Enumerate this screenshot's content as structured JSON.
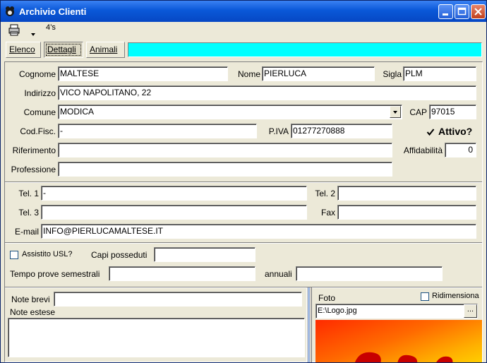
{
  "window": {
    "title": "Archivio Clienti"
  },
  "toolbar": {
    "sort_label": "4’s"
  },
  "tabs": [
    {
      "label": "Elenco"
    },
    {
      "label": "Dettagli"
    },
    {
      "label": "Animali"
    }
  ],
  "anagrafica": {
    "cognome_label": "Cognome",
    "cognome_value": "MALTESE",
    "nome_label": "Nome",
    "nome_value": "PIERLUCA",
    "sigla_label": "Sigla",
    "sigla_value": "PLM",
    "indirizzo_label": "Indirizzo",
    "indirizzo_value": "VICO NAPOLITANO, 22",
    "comune_label": "Comune",
    "comune_value": "MODICA",
    "cap_label": "CAP",
    "cap_value": "97015",
    "codfisc_label": "Cod.Fisc.",
    "codfisc_value": "-",
    "piva_label": "P.IVA",
    "piva_value": "01277270888",
    "attivo_label": "Attivo?",
    "attivo_checked": true,
    "riferimento_label": "Riferimento",
    "riferimento_value": "",
    "affidabilita_label": "Affidabilità",
    "affidabilita_value": "0",
    "professione_label": "Professione",
    "professione_value": ""
  },
  "contatti": {
    "tel1_label": "Tel. 1",
    "tel1_value": "-",
    "tel2_label": "Tel. 2",
    "tel2_value": "",
    "tel3_label": "Tel. 3",
    "tel3_value": "",
    "fax_label": "Fax",
    "fax_value": "",
    "email_label": "E-mail",
    "email_value": "INFO@PIERLUCAMALTESE.IT"
  },
  "usl": {
    "assistito_label": "Assistito USL?",
    "assistito_checked": false,
    "capi_label": "Capi posseduti",
    "capi_value": "",
    "tempo_label": "Tempo prove semestrali",
    "tempo_value": "",
    "annuali_label": "annuali",
    "annuali_value": ""
  },
  "note": {
    "brevi_label": "Note brevi",
    "brevi_value": "",
    "estese_label": "Note estese",
    "estese_value": ""
  },
  "foto": {
    "label": "Foto",
    "ridimensiona_label": "Ridimensiona",
    "ridimensiona_checked": false,
    "path_value": "E:\\Logo.jpg",
    "browse_label": "..."
  }
}
